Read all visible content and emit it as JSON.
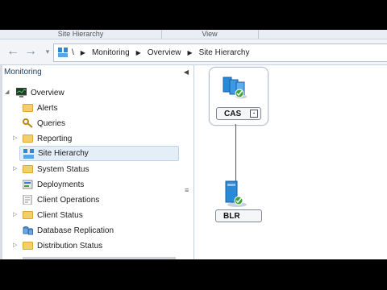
{
  "ribbon": {
    "tab1": "Site Hierarchy",
    "tab2": "View"
  },
  "addressbar": {
    "crumbs": [
      "\\",
      "Monitoring",
      "Overview",
      "Site Hierarchy"
    ],
    "back_icon": "back-arrow-icon",
    "forward_icon": "forward-arrow-icon"
  },
  "leftpane": {
    "title": "Monitoring",
    "items": [
      {
        "label": "Overview",
        "icon": "monitor-icon",
        "expanded": true
      },
      {
        "label": "Alerts",
        "icon": "folder-icon"
      },
      {
        "label": "Queries",
        "icon": "queries-icon"
      },
      {
        "label": "Reporting",
        "icon": "folder-icon"
      },
      {
        "label": "Site Hierarchy",
        "icon": "site-hierarchy-icon",
        "selected": true
      },
      {
        "label": "System Status",
        "icon": "folder-icon"
      },
      {
        "label": "Deployments",
        "icon": "deployments-icon"
      },
      {
        "label": "Client Operations",
        "icon": "client-operations-icon"
      },
      {
        "label": "Client Status",
        "icon": "folder-icon"
      },
      {
        "label": "Database Replication",
        "icon": "database-replication-icon"
      },
      {
        "label": "Distribution Status",
        "icon": "folder-icon"
      }
    ]
  },
  "hierarchy": {
    "parent": {
      "name": "CAS",
      "collapse": "-",
      "status": "ok"
    },
    "child": {
      "name": "BLR",
      "status": "ok"
    }
  },
  "colors": {
    "selection": "#e4eef9",
    "folder": "#f3cf6b",
    "server_blue": "#2a8ad8",
    "status_green": "#3fa534"
  }
}
